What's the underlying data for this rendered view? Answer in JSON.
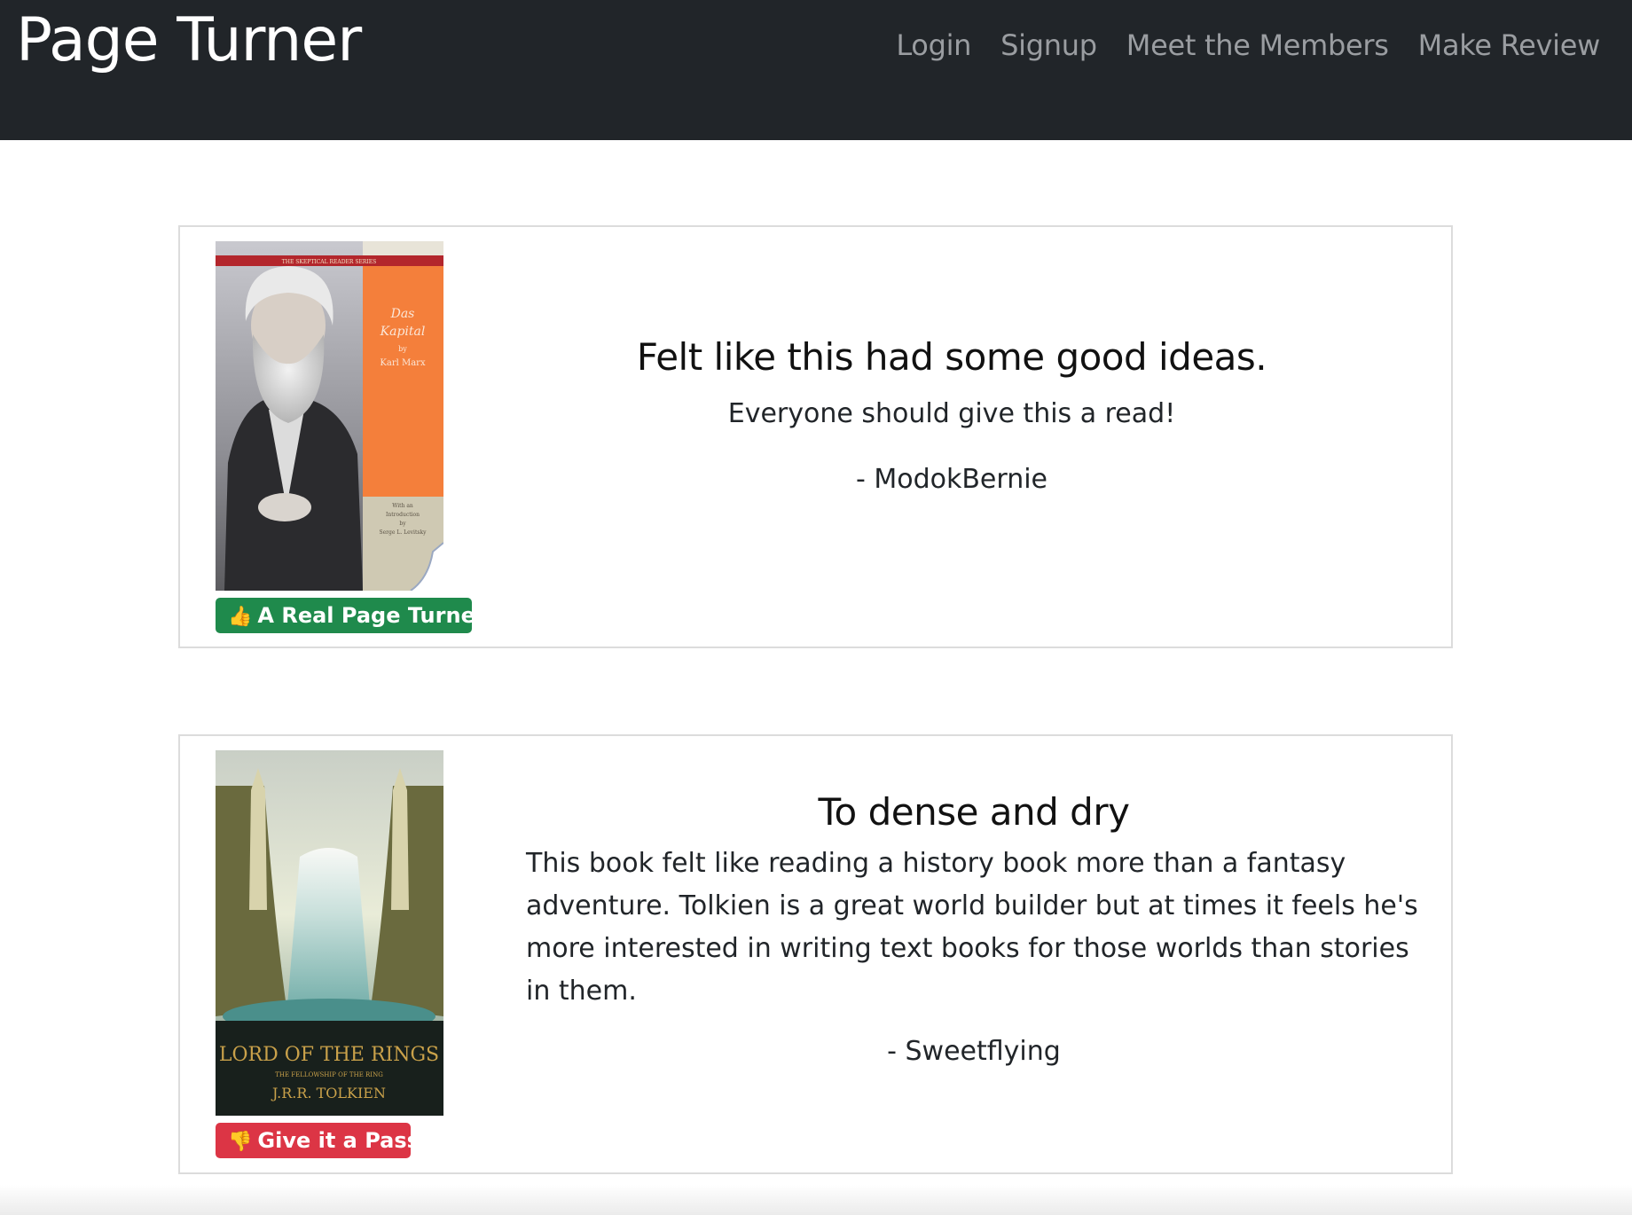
{
  "navbar": {
    "brand": "Page Turner",
    "links": [
      "Login",
      "Signup",
      "Meet the Members",
      "Make Review"
    ]
  },
  "reviews": [
    {
      "book_cover_icon": "das-kapital-cover-image",
      "cover_text": {
        "series": "THE SKEPTICAL READER SERIES",
        "title": "Das Kapital",
        "by": "by",
        "author": "Karl Marx",
        "intro": "With an Introduction by Serge L. Levitsky"
      },
      "badge_emoji": "👍",
      "badge_label": "A Real Page Turner",
      "badge_color": "#1f8a4c",
      "title": "Felt like this had some good ideas.",
      "body": "Everyone should give this a read!",
      "author": "- ModokBernie"
    },
    {
      "book_cover_icon": "lord-of-the-rings-cover-image",
      "cover_text": {
        "title": "LORD OF THE RINGS",
        "subtitle": "THE FELLOWSHIP OF THE RING",
        "author": "J.R.R. TOLKIEN"
      },
      "badge_emoji": "👎",
      "badge_label": "Give it a Pass",
      "badge_color": "#dc3545",
      "title": "To dense and dry",
      "body": "This book felt like reading a history book more than a fantasy adventure. Tolkien is a great world builder but at times it feels he's more interested in writing text books for those worlds than stories in them.",
      "author": "- Sweetflying"
    }
  ]
}
